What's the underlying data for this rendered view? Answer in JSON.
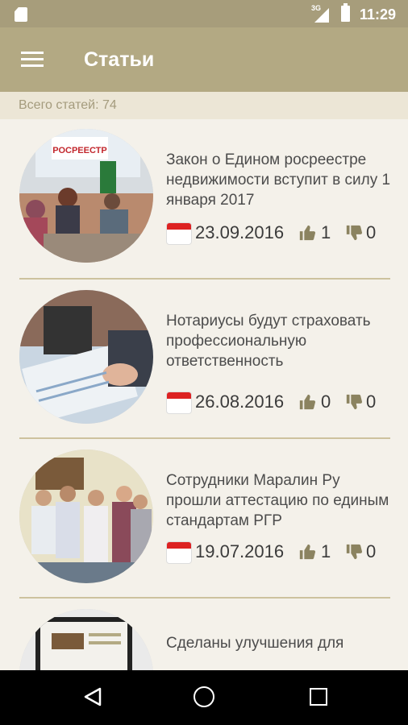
{
  "status_bar": {
    "network": "3G",
    "time": "11:29"
  },
  "app_bar": {
    "title": "Статьи"
  },
  "count_bar": {
    "text": "Всего статей: 74"
  },
  "articles": [
    {
      "title": "Закон о Едином росреестре недвижимости вступит в силу 1 января 2017",
      "date": "23.09.2016",
      "likes": "1",
      "dislikes": "0"
    },
    {
      "title": "Нотариусы будут страховать профессиональную ответственность",
      "date": "26.08.2016",
      "likes": "0",
      "dislikes": "0"
    },
    {
      "title": "Сотрудники Маралин Ру прошли аттестацию по единым стандартам РГР",
      "date": "19.07.2016",
      "likes": "1",
      "dislikes": "0"
    },
    {
      "title": "Сделаны улучшения для"
    }
  ],
  "thumb_sign_text": "РОСРЕЕСТР",
  "colors": {
    "accent": "#b3a983",
    "status": "#a79d7b",
    "divider": "#cdc29e"
  }
}
